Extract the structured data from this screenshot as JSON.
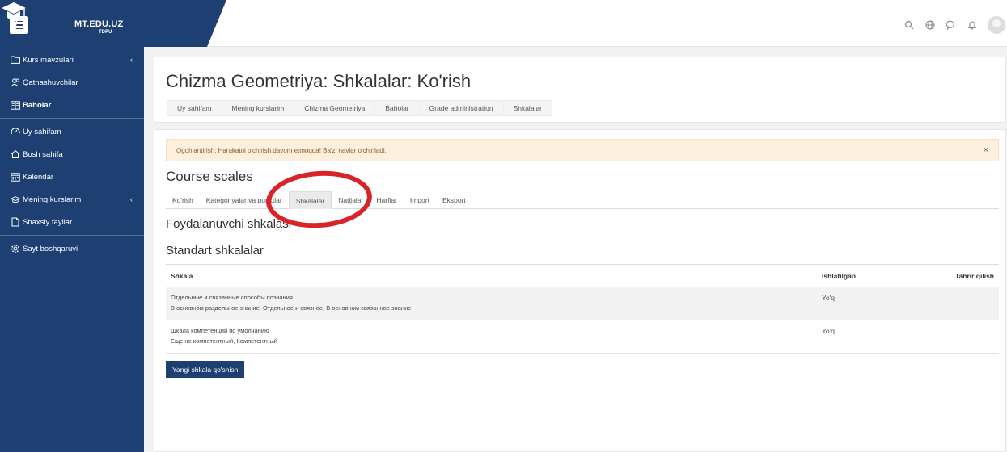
{
  "brand": {
    "name": "MT.EDU.UZ",
    "sub": "TDPU"
  },
  "nav_icons": [
    "search-icon",
    "globe-icon",
    "chat-icon",
    "bell-icon",
    "avatar"
  ],
  "sidebar": {
    "items": [
      {
        "label": "Kurs mavzulari",
        "icon": "folder-icon"
      },
      {
        "label": "Qatnashuvchilar",
        "icon": "users-icon"
      },
      {
        "label": "Baholar",
        "icon": "grades-icon"
      },
      {
        "label": "Uy sahifam",
        "icon": "dashboard-icon"
      },
      {
        "label": "Bosh sahifa",
        "icon": "home-icon"
      },
      {
        "label": "Kalendar",
        "icon": "calendar-icon"
      },
      {
        "label": "Mening kurslarim",
        "icon": "graduation-cap-icon"
      },
      {
        "label": "Shaxsiy fayllar",
        "icon": "file-icon"
      },
      {
        "label": "Sayt boshqaruvi",
        "icon": "gear-icon"
      }
    ]
  },
  "header": {
    "title": "Chizma Geometriya: Shkalalar: Ko'rish",
    "breadcrumb": [
      "Uy sahifam",
      "Mening kurslarim",
      "Chizma Geometriya",
      "Baholar",
      "Grade administration",
      "Shkalalar"
    ]
  },
  "alert": {
    "text": "Ogohlantirish: Harakatni o'chirish davom etmoqda! Ba'zi navlar o'chiriladi.",
    "close": "×"
  },
  "section_title": "Course scales",
  "tabs": [
    "Ko'rish",
    "Kategoriyalar va punktlar",
    "Shkalalar",
    "Natijalar",
    "Harflar",
    "Import",
    "Eksport"
  ],
  "subheading_custom": "Foydalanuvchi shkalasi",
  "subheading_standard": "Standart shkalalar",
  "table": {
    "headers": [
      "Shkala",
      "Ishlatilgan",
      "Tahrir qilish"
    ],
    "rows": [
      {
        "name": "Отдельные и связанные способы познания",
        "items": "В основном раздельное знание, Отдельное и связное, В основном связанное знание",
        "used": "Yo'q"
      },
      {
        "name": "Шкала компетенций по умолчанию",
        "items": "Еще не компетентный, Компетентный",
        "used": "Yo'q"
      }
    ]
  },
  "add_button": "Yangi shkala qo'shish",
  "colors": {
    "primary": "#1d3f72",
    "alert_bg": "#fcefdc",
    "annotation": "#d9232a"
  }
}
